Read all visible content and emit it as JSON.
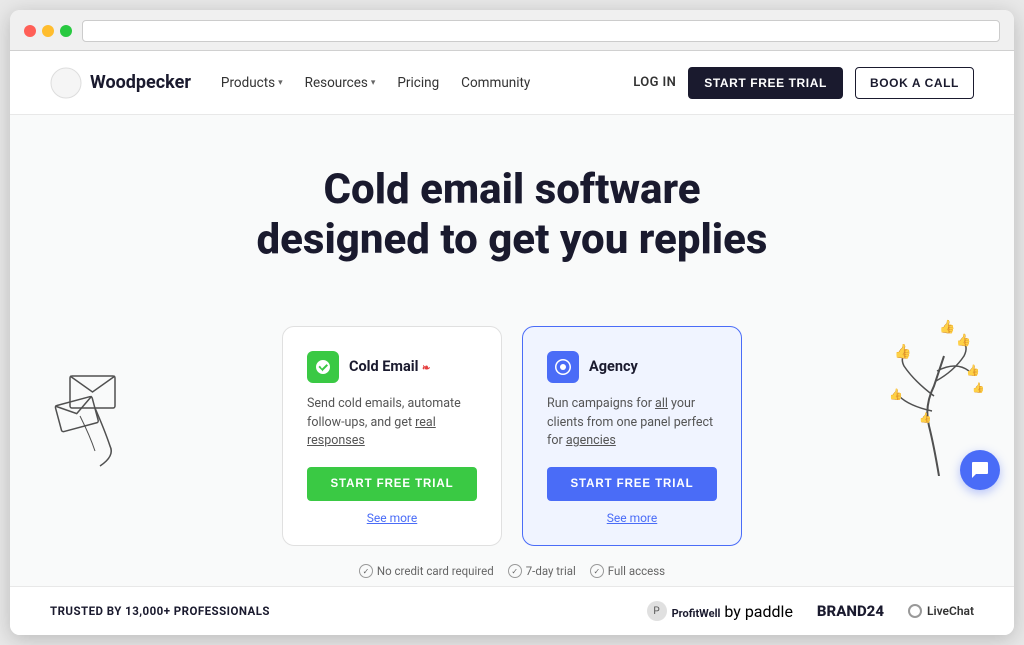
{
  "browser": {
    "dots": [
      "red",
      "yellow",
      "green"
    ]
  },
  "navbar": {
    "logo_text": "Woodpecker",
    "nav_items": [
      {
        "label": "Products",
        "has_dropdown": true
      },
      {
        "label": "Resources",
        "has_dropdown": true
      },
      {
        "label": "Pricing",
        "has_dropdown": false
      },
      {
        "label": "Community",
        "has_dropdown": false
      }
    ],
    "login_label": "LOG IN",
    "start_trial_label": "START FREE TRIAL",
    "book_call_label": "BOOK A CALL"
  },
  "hero": {
    "title_line1": "Cold email software",
    "title_line2": "designed to get you replies"
  },
  "cards": [
    {
      "id": "cold-email",
      "title": "Cold Email",
      "title_highlight": "❧",
      "icon": "🪶",
      "icon_bg": "green",
      "description": "Send cold emails, automate follow-ups, and get real responses",
      "cta_label": "START FREE TRIAL",
      "see_more": "See more"
    },
    {
      "id": "agency",
      "title": "Agency",
      "icon": "🪶",
      "icon_bg": "blue",
      "description": "Run campaigns for all your clients from one panel perfect for agencies",
      "cta_label": "START FREE TRIAL",
      "see_more": "See more"
    }
  ],
  "trust_items": [
    {
      "label": "No credit card required"
    },
    {
      "label": "7-day trial"
    },
    {
      "label": "Full access"
    }
  ],
  "bottom_bar": {
    "trusted_text": "TRUSTED BY 13,000+ PROFESSIONALS",
    "partners": [
      {
        "name": "ProfitWell",
        "sub": "by paddle"
      },
      {
        "name": "BRAND24",
        "sub": ""
      },
      {
        "name": "LiveChat",
        "sub": ""
      }
    ]
  },
  "chat_fab": {
    "icon": "💬"
  }
}
